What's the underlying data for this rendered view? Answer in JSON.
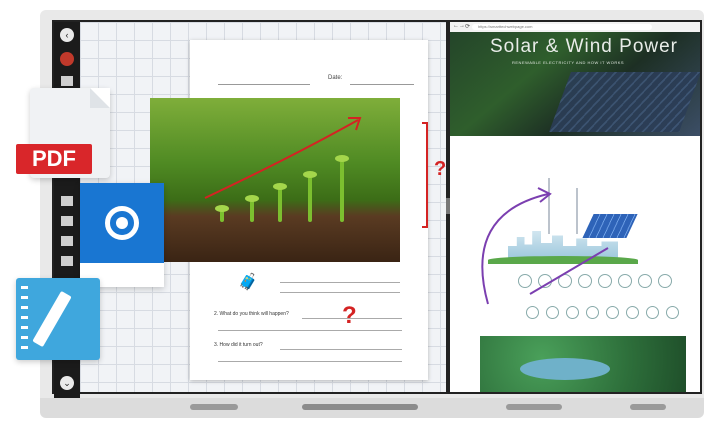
{
  "left_toolbar": {
    "buttons": [
      "back-arrow-icon",
      "avatar-icon",
      "camera-icon",
      "stamp-icon",
      "grid-icon",
      "image-icon",
      "undo-icon",
      "down-arrow-icon"
    ]
  },
  "worksheet": {
    "date_label": "Date:",
    "question_mark_1": "?",
    "question_mark_2": "?",
    "question_1": "2. What do you think will happen?",
    "question_2": "3. How did it turn out?"
  },
  "browser": {
    "address": "https://smarttechwebpage.com",
    "nav_back": "←",
    "nav_forward": "→",
    "nav_refresh": "⟳",
    "hero_title": "Solar & Wind Power",
    "hero_subtitle": "RENEWABLE ELECTRICITY AND HOW IT WORKS"
  },
  "overlay_icons": {
    "pdf_label": "PDF"
  },
  "colors": {
    "accent_red": "#d42323",
    "pdf_red": "#d9262a",
    "chrome_blue": "#1976d2",
    "notebook_blue": "#3fa7dd"
  }
}
